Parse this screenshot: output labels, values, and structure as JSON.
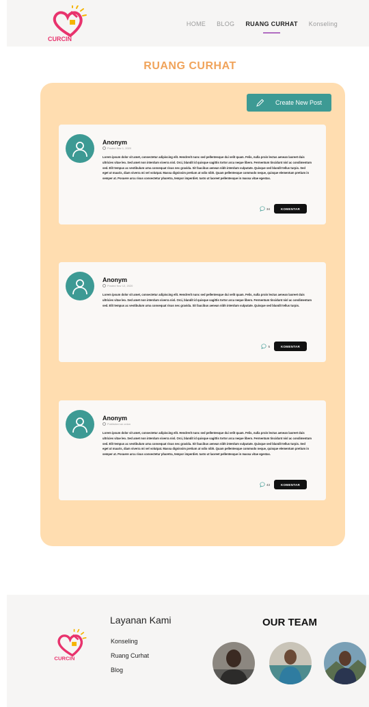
{
  "brand": {
    "logo_text": "CURCIN"
  },
  "nav": {
    "items": [
      {
        "label": "HOME",
        "active": false
      },
      {
        "label": "BLOG",
        "active": false
      },
      {
        "label": "RUANG CURHAT",
        "active": true
      },
      {
        "label": "Konseling",
        "active": false
      }
    ]
  },
  "page": {
    "title": "RUANG CURHAT"
  },
  "toolbar": {
    "create_label": "Create New Post"
  },
  "posts": [
    {
      "author": "Anonym",
      "meta": "Posted  Nov 1, 2020",
      "body": "Lorem ipsum dolor sit amet, consectetur adipiscing elit. Hendrerit nunc sed pellentesque dui velit quam. Felis, nulla proin lectus aenean laoreet duis ultricies vitae leo. Sed amet non interdum viverra nisl. Orci, blandit id quisque sagittis tortor arcu neque libero. Fermentum tincidunt nisl ac condimentum sed. Elit tempus ac vestibulum urna consequat risus nec gravida. Sit faucibus aenean nibh interdum vulputate. Quisque sed blandit tellus turpis. Sed eget ut mauris, diam viverra mi vel volutpat. Massa dignissim pretium at odio nibh. Quam pellentesque commodo neque, quisque elementum pretium in semper at. Posuere arcu risus consectetur pharetra, tempor imperdiet. Iusto ut laoreet pellentesque in massa vitae egestas.",
      "comment_count": "34",
      "comment_label": "KOMENTAR"
    },
    {
      "author": "Anonym",
      "meta": "Posted  Nov 12, 2020",
      "body": "Lorem ipsum dolor sit amet, consectetur adipiscing elit. Hendrerit nunc sed pellentesque dui velit quam. Felis, nulla proin lectus aenean laoreet duis ultricies vitae leo. Sed amet non interdum viverra nisl. Orci, blandit id quisque sagittis tortor arcu neque libero. Fermentum tincidunt nisl ac condimentum sed. Elit tempus ac vestibulum urna consequat risus nec gravida. Sit faucibus aenean nibh interdum vulputate. Quisque sed blandit tellus turpis.",
      "comment_count": "5",
      "comment_label": "KOMENTAR"
    },
    {
      "author": "Anonym",
      "meta": "Published an onion",
      "body": "Lorem ipsum dolor sit amet, consectetur adipiscing elit. Hendrerit nunc sed pellentesque dui velit quam. Felis, nulla proin lectus aenean laoreet duis ultricies vitae leo. Sed amet non interdum viverra nisl. Orci, blandit id quisque sagittis tortor arcu neque libero. Fermentum tincidunt nisl ac condimentum sed. Elit tempus ac vestibulum urna consequat risus nec gravida. Sit faucibus aenean nibh interdum vulputate. Quisque sed blandit tellus turpis. Sed eget ut mauris, diam viverra mi vel volutpat. Massa dignissim pretium at odio nibh. Quam pellentesque commodo neque, quisque elementum pretium in semper at. Posuere arcu risus consectetur pharetra, tempor imperdiet. Iusto ut laoreet pellentesque in massa vitae egestas.",
      "comment_count": "43",
      "comment_label": "KOMENTAR"
    }
  ],
  "footer": {
    "services_title": "Layanan Kami",
    "services": [
      "Konseling",
      "Ruang Curhat",
      "Blog"
    ],
    "team_title": "OUR TEAM"
  },
  "colors": {
    "accent_teal": "#3d9a94",
    "panel_bg": "#ffddb0",
    "title_orange": "#f0a35a",
    "logo_pink": "#e8336d",
    "logo_yellow": "#f5b400"
  }
}
